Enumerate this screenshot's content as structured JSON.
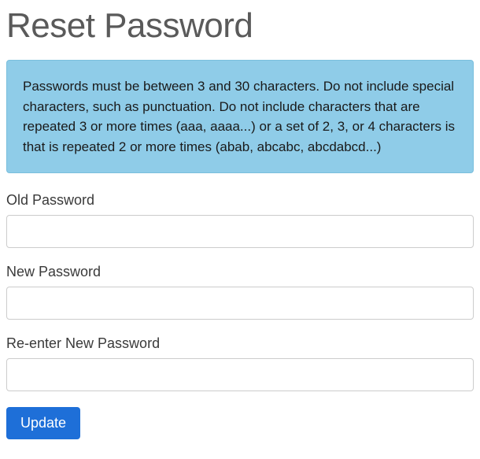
{
  "page": {
    "title": "Reset Password"
  },
  "info": {
    "message": "Passwords must be between 3 and 30 characters. Do not include special characters, such as punctuation. Do not include characters that are repeated 3 or more times (aaa, aaaa...) or a set of 2, 3, or 4 characters is that is repeated 2 or more times (abab, abcabc, abcdabcd...)"
  },
  "form": {
    "old_password": {
      "label": "Old Password",
      "value": ""
    },
    "new_password": {
      "label": "New Password",
      "value": ""
    },
    "reenter_password": {
      "label": "Re-enter New Password",
      "value": ""
    },
    "submit_label": "Update"
  }
}
